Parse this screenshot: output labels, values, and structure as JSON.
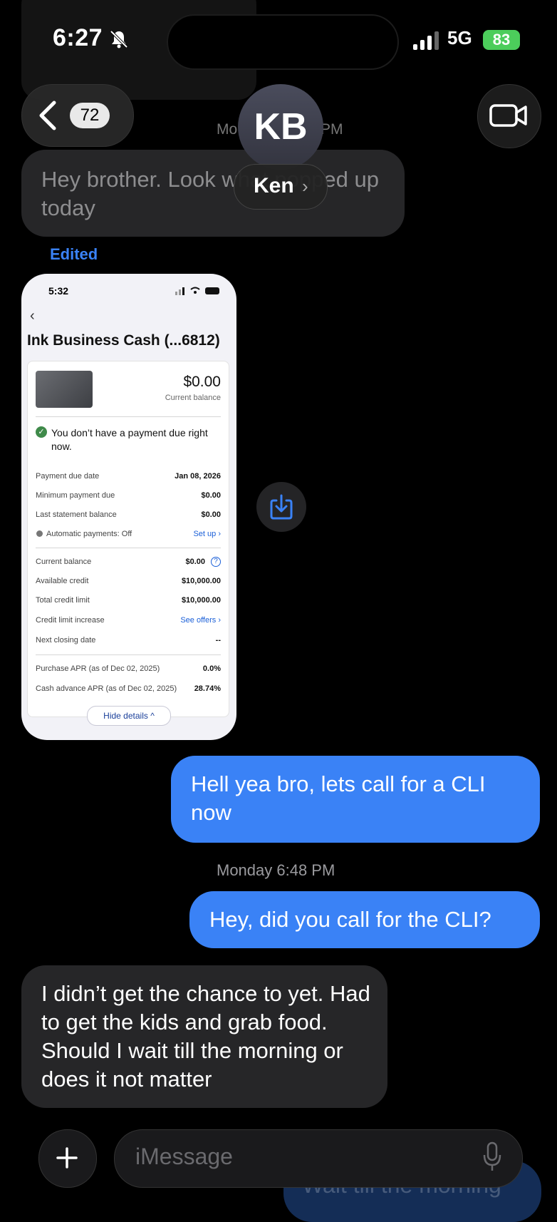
{
  "status_bar": {
    "time": "6:27",
    "network": "5G",
    "battery": "83"
  },
  "header": {
    "back_count": "72",
    "avatar_initials": "KB",
    "contact_name": "Ken",
    "partial_timestamp_left": "Mo",
    "partial_timestamp_right": "PM"
  },
  "messages": [
    {
      "side": "incoming",
      "text": "Hey brother.  Look what popped up today",
      "edited_label": "Edited"
    },
    {
      "side": "outgoing",
      "text": "Hell yea bro, lets call for a CLI now"
    },
    {
      "side": "timestamp",
      "text": "Monday 6:48 PM"
    },
    {
      "side": "outgoing",
      "text": "Hey, did you call for the CLI?"
    },
    {
      "side": "incoming",
      "text": "I didn’t get the chance to yet. Had to get the kids and grab food. Should I wait till the morning or does it not matter"
    }
  ],
  "screenshot": {
    "time": "5:32",
    "title": "Ink Business Cash (...6812)",
    "balance": "$0.00",
    "balance_label": "Current balance",
    "payment_status": "You don’t have a payment due right now.",
    "rows1": [
      {
        "label": "Payment due date",
        "value": "Jan 08, 2026"
      },
      {
        "label": "Minimum payment due",
        "value": "$0.00"
      },
      {
        "label": "Last statement balance",
        "value": "$0.00"
      },
      {
        "label": "Automatic payments: Off",
        "link": "Set up ›"
      }
    ],
    "rows2": [
      {
        "label": "Current balance",
        "value": "$0.00"
      },
      {
        "label": "Available credit",
        "value": "$10,000.00"
      },
      {
        "label": "Total credit limit",
        "value": "$10,000.00"
      },
      {
        "label": "Credit limit increase",
        "link": "See offers ›"
      },
      {
        "label": "Next closing date",
        "value": "--"
      }
    ],
    "rows3": [
      {
        "label": "Purchase APR (as of Dec 02, 2025)",
        "value": "0.0%"
      },
      {
        "label": "Cash advance APR (as of Dec 02, 2025)",
        "value": "28.74%"
      }
    ],
    "hide_details": "Hide details ^"
  },
  "composer": {
    "placeholder": "iMessage",
    "ghost_text": "Wait till the morning"
  }
}
